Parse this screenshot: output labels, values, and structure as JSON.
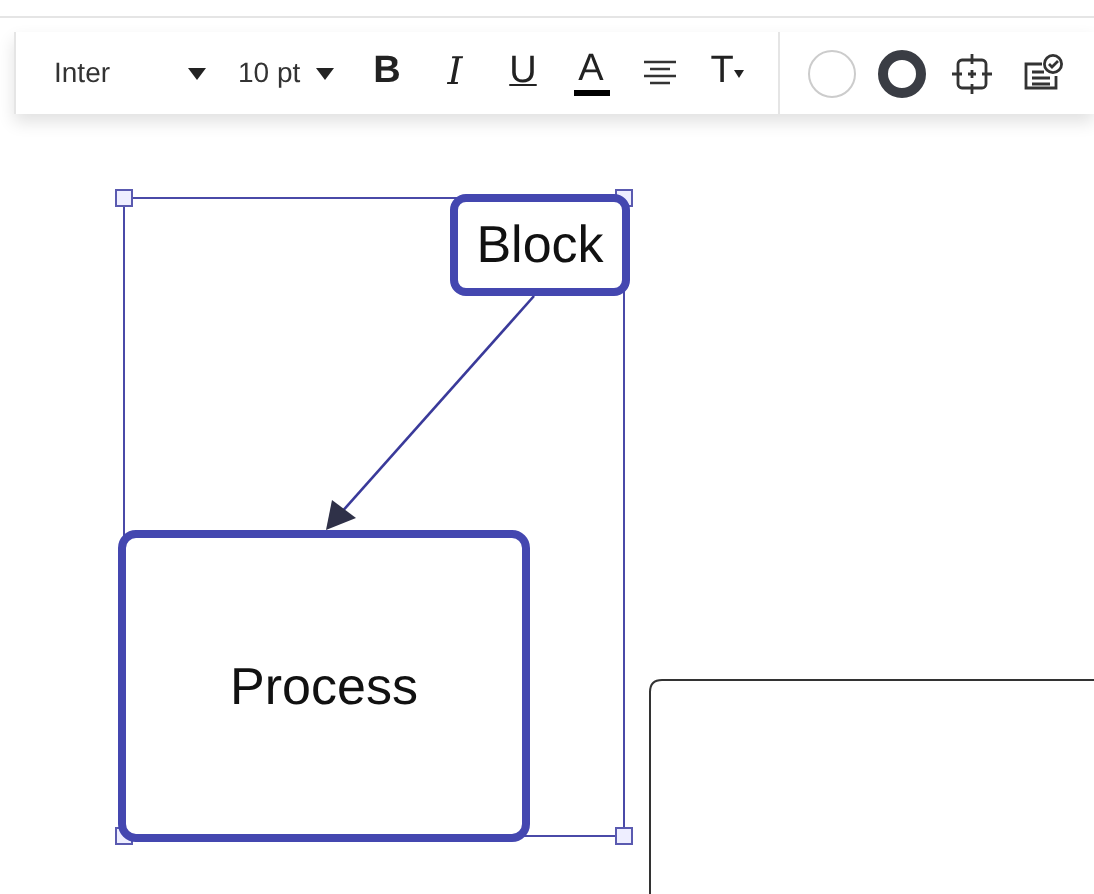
{
  "toolbar": {
    "items": [
      {
        "kind": "font",
        "label": "Inter"
      },
      {
        "kind": "size",
        "label": "10 pt"
      },
      {
        "kind": "bold",
        "label": "B"
      },
      {
        "kind": "italic",
        "label": "I"
      },
      {
        "kind": "underline",
        "label": "U"
      },
      {
        "kind": "color",
        "label": "A"
      },
      {
        "kind": "align"
      },
      {
        "kind": "text-style",
        "label": "T"
      },
      {
        "kind": "fill"
      },
      {
        "kind": "stroke"
      },
      {
        "kind": "frame"
      },
      {
        "kind": "checklist"
      }
    ]
  },
  "canvas": {
    "nodes": [
      {
        "kind": "block",
        "label": "Block",
        "selected": true
      },
      {
        "kind": "process",
        "label": "Process",
        "selected": true
      }
    ]
  }
}
